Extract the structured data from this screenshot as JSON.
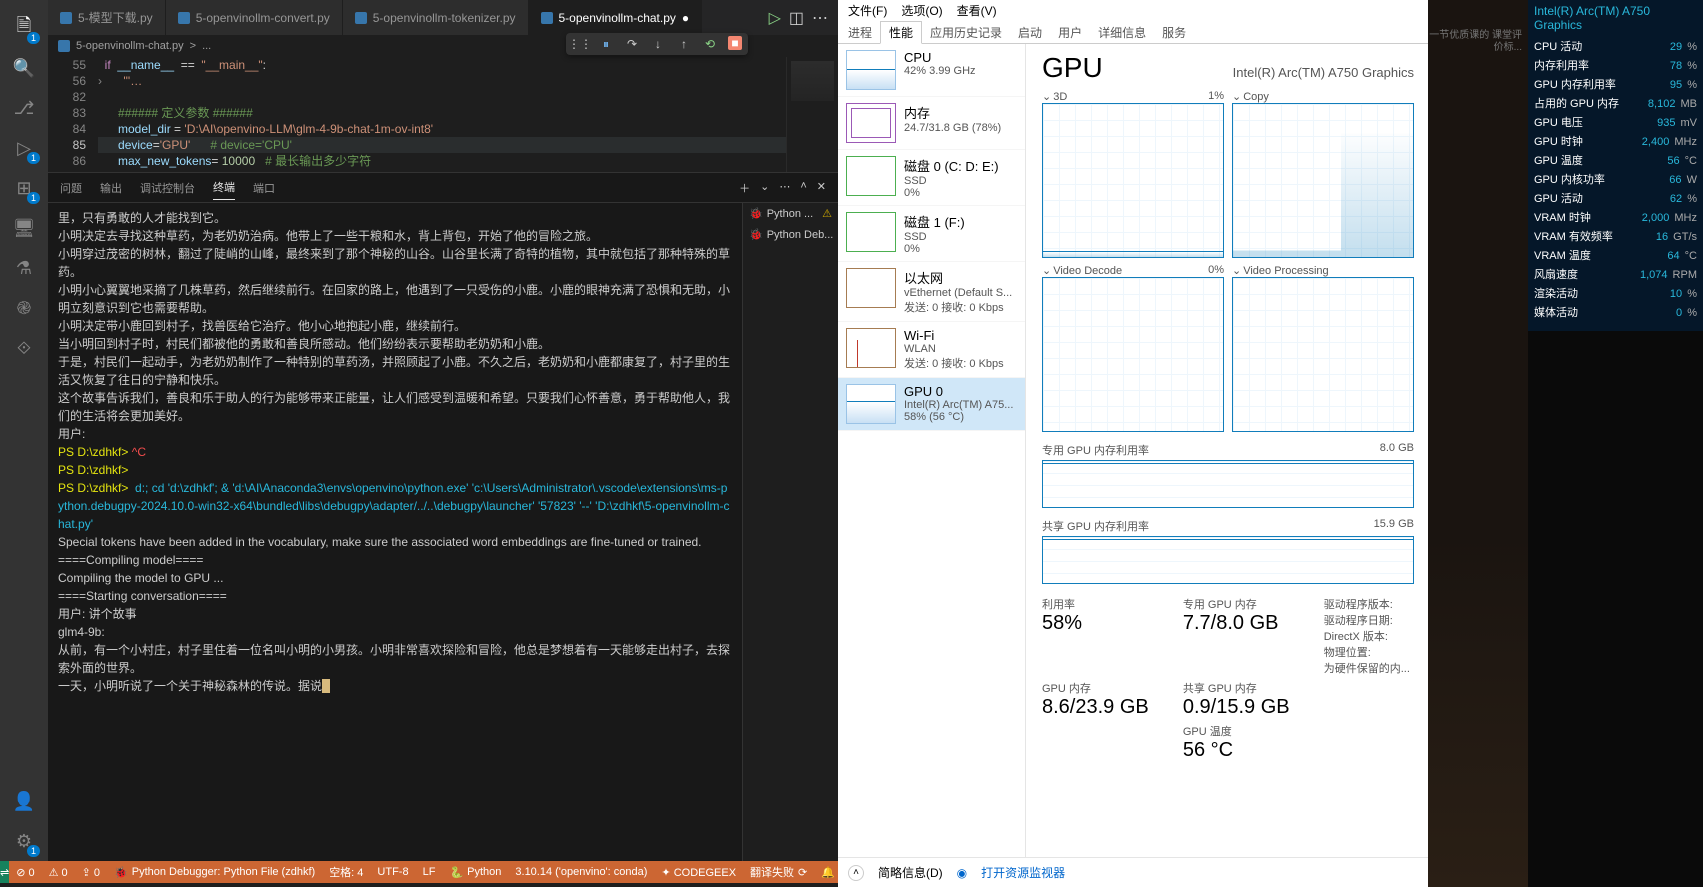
{
  "vscode": {
    "tabs": [
      {
        "label": "5-模型下载.py"
      },
      {
        "label": "5-openvinollm-convert.py"
      },
      {
        "label": "5-openvinollm-tokenizer.py"
      },
      {
        "label": "5-openvinollm-chat.py",
        "active": true,
        "dirty": true
      }
    ],
    "breadcrumb": {
      "file": "5-openvinollm-chat.py",
      "sep": ">",
      "more": "..."
    },
    "code": {
      "lines": [
        {
          "n": "55",
          "html": "<span class='kw'>if</span>  <span class='nm'>__name__</span>  ==  <span class='str'>\"__main__\"</span>:"
        },
        {
          "n": "56",
          "fold": true,
          "html": "    <span class='str'>'''…</span>"
        },
        {
          "n": "82",
          "": true,
          "html": ""
        },
        {
          "n": "83",
          "html": "    <span class='cm'>###### 定义参数 ######</span>"
        },
        {
          "n": "84",
          "html": "    <span class='nm'>model_dir</span> = <span class='str'>'D:\\AI\\openvino-LLM\\glm-4-9b-chat-1m-ov-int8'</span>"
        },
        {
          "n": "85",
          "hl": true,
          "html": "    <span class='nm'>device</span>=<span class='str'>'GPU'</span>      <span class='cm'># device='CPU'</span>"
        },
        {
          "n": "86",
          "html": "    <span class='nm'>max_new_tokens</span>= <span class='num'>10000</span>   <span class='cm'># 最长输出多少字符</span>"
        }
      ]
    },
    "panel_tabs": [
      "问题",
      "输出",
      "调试控制台",
      "终端",
      "端口"
    ],
    "panel_active": "终端",
    "terminals": [
      {
        "label": "Python ...",
        "warn": true
      },
      {
        "label": "Python Deb..."
      }
    ],
    "terminal_lines": [
      {
        "cls": "cn",
        "t": "里，只有勇敢的人才能找到它。"
      },
      {
        "cls": "cn",
        "t": ""
      },
      {
        "cls": "cn",
        "t": "小明决定去寻找这种草药，为老奶奶治病。他带上了一些干粮和水，背上背包，开始了他的冒险之旅。"
      },
      {
        "cls": "cn",
        "t": ""
      },
      {
        "cls": "cn",
        "t": "小明穿过茂密的树林，翻过了陡峭的山峰，最终来到了那个神秘的山谷。山谷里长满了奇特的植物，其中就包括了那种特殊的草药。"
      },
      {
        "cls": "cn",
        "t": ""
      },
      {
        "cls": "cn",
        "t": "小明小心翼翼地采摘了几株草药，然后继续前行。在回家的路上，他遇到了一只受伤的小鹿。小鹿的眼神充满了恐惧和无助，小明立刻意识到它也需要帮助。"
      },
      {
        "cls": "cn",
        "t": ""
      },
      {
        "cls": "cn",
        "t": "小明决定带小鹿回到村子，找兽医给它治疗。他小心地抱起小鹿，继续前行。"
      },
      {
        "cls": "cn",
        "t": ""
      },
      {
        "cls": "cn",
        "t": "当小明回到村子时，村民们都被他的勇敢和善良所感动。他们纷纷表示要帮助老奶奶和小鹿。"
      },
      {
        "cls": "cn",
        "t": ""
      },
      {
        "cls": "cn",
        "t": "于是，村民们一起动手，为老奶奶制作了一种特别的草药汤，并照顾起了小鹿。不久之后，老奶奶和小鹿都康复了，村子里的生活又恢复了往日的宁静和快乐。"
      },
      {
        "cls": "cn",
        "t": ""
      },
      {
        "cls": "cn",
        "t": "这个故事告诉我们，善良和乐于助人的行为能够带来正能量，让人们感受到温暖和希望。只要我们心怀善意，勇于帮助他人，我们的生活将会更加美好。"
      },
      {
        "cls": "cn",
        "t": "用户:"
      },
      {
        "cls": "prm",
        "t": "PS D:\\zdhkf> ^C",
        "red": true
      },
      {
        "cls": "prm",
        "t": "PS D:\\zdhkf>"
      },
      {
        "cls": "cmd",
        "t": "PS D:\\zdhkf>  d:; cd 'd:\\zdhkf'; & 'd:\\AI\\Anaconda3\\envs\\openvino\\python.exe' 'c:\\Users\\Administrator\\.vscode\\extensions\\ms-python.debugpy-2024.10.0-win32-x64\\bundled\\libs\\debugpy\\adapter/../..\\debugpy\\launcher' '57823' '--' 'D:\\zdhkf\\5-openvinollm-chat.py'"
      },
      {
        "cls": "cn",
        "t": "Special tokens have been added in the vocabulary, make sure the associated word embeddings are fine-tuned or trained."
      },
      {
        "cls": "cn",
        "t": "====Compiling model===="
      },
      {
        "cls": "cn",
        "t": "Compiling the model to GPU ..."
      },
      {
        "cls": "cn",
        "t": "====Starting conversation===="
      },
      {
        "cls": "cn",
        "t": "用户: 讲个故事"
      },
      {
        "cls": "cn",
        "t": "glm4-9b:"
      },
      {
        "cls": "cn",
        "t": "从前，有一个小村庄，村子里住着一位名叫小明的小男孩。小明非常喜欢探险和冒险，他总是梦想着有一天能够走出村子，去探索外面的世界。"
      },
      {
        "cls": "cn",
        "t": ""
      },
      {
        "cls": "cn",
        "t": "一天，小明听说了一个关于神秘森林的传说。据说",
        "cursor": true
      }
    ],
    "status": {
      "remote": "⇌",
      "errors": "⊘ 0",
      "warnings": "⚠ 0",
      "ports": "⇪ 0",
      "debugger": "Python Debugger: Python File (zdhkf)",
      "ln_col": "空格: 4",
      "encoding": "UTF-8",
      "eol": "LF",
      "lang": "Python",
      "interpreter": "3.10.14 ('openvino': conda)",
      "codegeex": "✦ CODEGEEX",
      "translate": "翻译失败",
      "bell": "🔔"
    }
  },
  "taskmgr": {
    "menu": [
      "文件(F)",
      "选项(O)",
      "查看(V)"
    ],
    "tabs": [
      "进程",
      "性能",
      "应用历史记录",
      "启动",
      "用户",
      "详细信息",
      "服务"
    ],
    "active_tab": "性能",
    "left": [
      {
        "k": "cpu",
        "t1": "CPU",
        "t2": "42%  3.99 GHz"
      },
      {
        "k": "mem",
        "t1": "内存",
        "t2": "24.7/31.8 GB (78%)"
      },
      {
        "k": "disk",
        "t1": "磁盘 0 (C: D: E:)",
        "t2": "SSD",
        "t3": "0%"
      },
      {
        "k": "disk",
        "t1": "磁盘 1 (F:)",
        "t2": "SSD",
        "t3": "0%"
      },
      {
        "k": "eth",
        "t1": "以太网",
        "t2": "vEthernet (Default S...",
        "t3": "发送: 0  接收: 0 Kbps"
      },
      {
        "k": "wifi",
        "t1": "Wi-Fi",
        "t2": "WLAN",
        "t3": "发送: 0  接收: 0 Kbps"
      },
      {
        "k": "gpu",
        "t1": "GPU 0",
        "t2": "Intel(R) Arc(TM) A75...",
        "t3": "58% (56 °C)",
        "sel": true
      }
    ],
    "right": {
      "title": "GPU",
      "subtitle": "Intel(R) Arc(TM) A750 Graphics",
      "graphs": [
        {
          "label": "3D",
          "pct": "1%",
          "line": "low"
        },
        {
          "label": "Copy",
          "pct": "",
          "line": "step"
        },
        {
          "label": "Video Decode",
          "pct": "0%",
          "line": ""
        },
        {
          "label": "Video Processing",
          "pct": "",
          "line": ""
        }
      ],
      "mem1": {
        "label": "专用 GPU 内存利用率",
        "cap": "8.0 GB"
      },
      "mem2": {
        "label": "共享 GPU 内存利用率",
        "cap": "15.9 GB"
      },
      "stats": {
        "util_lbl": "利用率",
        "util": "58%",
        "ded_lbl": "专用 GPU 内存",
        "ded": "7.7/8.0 GB",
        "drv1_lbl": "驱动程序版本:",
        "drv2_lbl": "驱动程序日期:",
        "drv3_lbl": "DirectX 版本:",
        "drv4_lbl": "物理位置:",
        "drv5_lbl": "为硬件保留的内...",
        "gpumem_lbl": "GPU 内存",
        "gpumem": "8.6/23.9 GB",
        "shared_lbl": "共享 GPU 内存",
        "shared": "0.9/15.9 GB",
        "temp_lbl": "GPU 温度",
        "temp": "56 °C"
      }
    },
    "footer": {
      "brief": "简略信息(D)",
      "link": "打开资源监视器"
    }
  },
  "overlay": {
    "title": "Intel(R) Arc(TM) A750 Graphics",
    "rows": [
      {
        "l": "CPU 活动",
        "v": "29",
        "u": "%"
      },
      {
        "l": "内存利用率",
        "v": "78",
        "u": "%"
      },
      {
        "l": "GPU 内存利用率",
        "v": "95",
        "u": "%"
      },
      {
        "l": "占用的 GPU 内存",
        "v": "8,102",
        "u": "MB"
      },
      {
        "l": "GPU 电压",
        "v": "935",
        "u": "mV"
      },
      {
        "l": "GPU 时钟",
        "v": "2,400",
        "u": "MHz"
      },
      {
        "l": "GPU 温度",
        "v": "56",
        "u": "°C"
      },
      {
        "l": "GPU 内核功率",
        "v": "66",
        "u": "W"
      },
      {
        "l": "GPU 活动",
        "v": "62",
        "u": "%"
      },
      {
        "l": "VRAM 时钟",
        "v": "2,000",
        "u": "MHz"
      },
      {
        "l": "VRAM 有效频率",
        "v": "16",
        "u": "GT/s"
      },
      {
        "l": "VRAM 温度",
        "v": "64",
        "u": "°C"
      },
      {
        "l": "风扇速度",
        "v": "1,074",
        "u": "RPM"
      },
      {
        "l": "渲染活动",
        "v": "10",
        "u": "%"
      },
      {
        "l": "媒体活动",
        "v": "0",
        "u": "%"
      }
    ]
  },
  "wallpaper": {
    "text": "一节优质课的\n课堂评价标..."
  }
}
